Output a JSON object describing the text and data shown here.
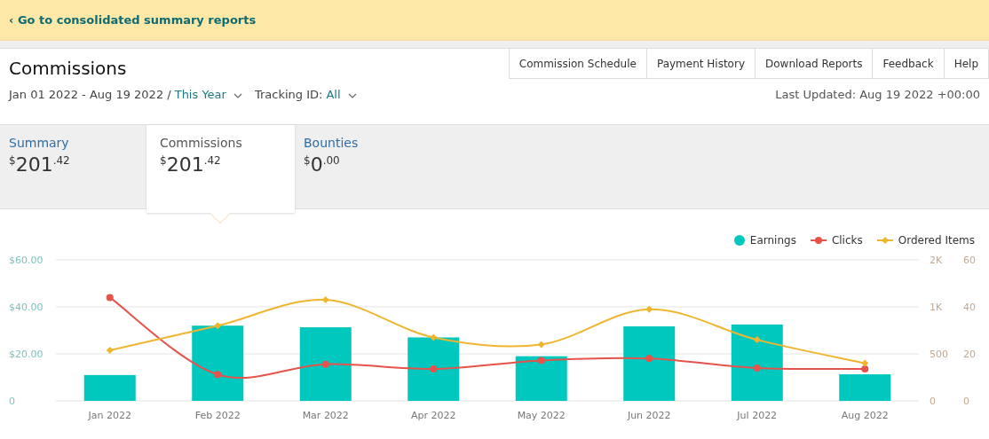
{
  "banner": {
    "link": "‹ Go to consolidated summary reports"
  },
  "page_title": "Commissions",
  "nav_buttons": [
    "Commission Schedule",
    "Payment History",
    "Download Reports",
    "Feedback",
    "Help"
  ],
  "filters": {
    "date_range": "Jan 01 2022 - Aug 19 2022 /",
    "period": "This Year",
    "tracking_label": "Tracking ID:",
    "tracking_value": "All"
  },
  "last_updated": "Last Updated: Aug 19 2022 +00:00",
  "summary_tabs": [
    {
      "label": "Summary",
      "currency": "$",
      "whole": "201",
      "fraction": ".42",
      "selected": false
    },
    {
      "label": "Commissions",
      "currency": "$",
      "whole": "201",
      "fraction": ".42",
      "selected": true
    },
    {
      "label": "Bounties",
      "currency": "$",
      "whole": "0",
      "fraction": ".00",
      "selected": false
    }
  ],
  "chart": {
    "chart_data": {
      "type": "bar",
      "categories": [
        "Jan 2022",
        "Feb 2022",
        "Mar 2022",
        "Apr 2022",
        "May 2022",
        "Jun 2022",
        "Jul 2022",
        "Aug 2022"
      ],
      "series": [
        {
          "name": "Earnings",
          "color": "#00c8bf",
          "values": [
            11,
            32,
            31.3,
            27,
            19,
            31.7,
            32.5,
            11.3
          ]
        },
        {
          "name": "Clicks",
          "color": "#e5534b",
          "type": "line",
          "marker": "circle",
          "axis": "y2",
          "values": [
            1100,
            280,
            390,
            340,
            430,
            450,
            350,
            340
          ]
        },
        {
          "name": "Ordered Items",
          "color": "#f0b52e",
          "type": "line",
          "marker": "diamond",
          "axis": "y3",
          "values": [
            21.5,
            32,
            43,
            27,
            24,
            39,
            26,
            16
          ]
        }
      ],
      "ylim": [
        0,
        60
      ],
      "yticks": [
        {
          "value": 0,
          "label": "0"
        },
        {
          "value": 20,
          "label": "$20.00"
        },
        {
          "value": 40,
          "label": "$40.00"
        },
        {
          "value": 60,
          "label": "$60.00"
        }
      ],
      "y2lim": [
        0,
        1500
      ],
      "y2ticks": [
        {
          "value": 0,
          "label": "0"
        },
        {
          "value": 500,
          "label": "500"
        },
        {
          "value": 1000,
          "label": "1K"
        },
        {
          "value": 1500,
          "label": "2K"
        }
      ],
      "y3lim": [
        0,
        60
      ],
      "y3ticks": [
        0,
        20,
        40,
        60
      ]
    }
  }
}
